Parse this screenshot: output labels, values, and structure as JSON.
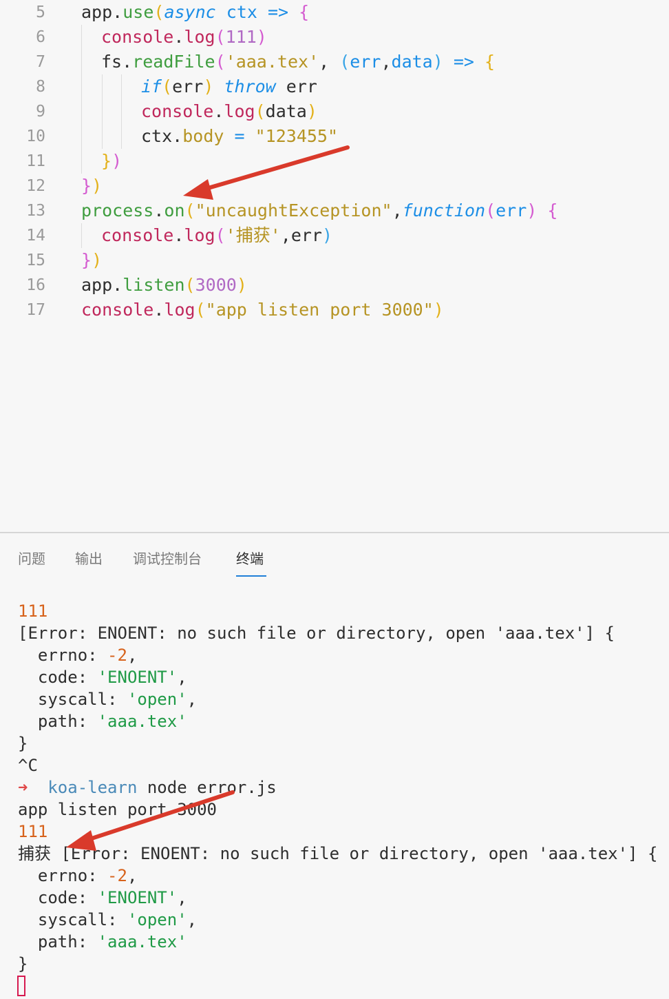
{
  "editor": {
    "lines": [
      {
        "n": "5",
        "segs": [
          [
            "app",
            "id"
          ],
          [
            ".",
            "punc"
          ],
          [
            "use",
            "fn"
          ],
          [
            "(",
            "br1"
          ],
          [
            "async",
            "kw"
          ],
          [
            " ",
            ""
          ],
          [
            "ctx",
            "param"
          ],
          [
            " ",
            ""
          ],
          [
            "=>",
            "arrow"
          ],
          [
            " ",
            ""
          ],
          [
            "{",
            "br2"
          ]
        ]
      },
      {
        "n": "6",
        "segs": [
          [
            "console",
            "log"
          ],
          [
            ".",
            "punc"
          ],
          [
            "log",
            "log"
          ],
          [
            "(",
            "br2"
          ],
          [
            "111",
            "num"
          ],
          [
            ")",
            "br2"
          ]
        ]
      },
      {
        "n": "7",
        "segs": [
          [
            "fs",
            "id"
          ],
          [
            ".",
            "punc"
          ],
          [
            "readFile",
            "fn"
          ],
          [
            "(",
            "br2"
          ],
          [
            "'aaa.tex'",
            "str"
          ],
          [
            ", ",
            ""
          ],
          [
            "(",
            "br3"
          ],
          [
            "err",
            "param"
          ],
          [
            ",",
            "punc"
          ],
          [
            "data",
            "param"
          ],
          [
            ")",
            "br3"
          ],
          [
            " ",
            ""
          ],
          [
            "=>",
            "arrow"
          ],
          [
            " ",
            ""
          ],
          [
            "{",
            "br1"
          ]
        ]
      },
      {
        "n": "8",
        "segs": [
          [
            "if",
            "kw"
          ],
          [
            "(",
            "br1"
          ],
          [
            "err",
            "id"
          ],
          [
            ")",
            "br1"
          ],
          [
            " ",
            ""
          ],
          [
            "throw",
            "kw"
          ],
          [
            " ",
            ""
          ],
          [
            "err",
            "id"
          ]
        ]
      },
      {
        "n": "9",
        "segs": [
          [
            "console",
            "log"
          ],
          [
            ".",
            "punc"
          ],
          [
            "log",
            "log"
          ],
          [
            "(",
            "br1"
          ],
          [
            "data",
            "id"
          ],
          [
            ")",
            "br1"
          ]
        ]
      },
      {
        "n": "10",
        "segs": [
          [
            "ctx",
            "id"
          ],
          [
            ".",
            "punc"
          ],
          [
            "body",
            "str"
          ],
          [
            " ",
            ""
          ],
          [
            "=",
            "arrow"
          ],
          [
            " ",
            ""
          ],
          [
            "\"123455\"",
            "str"
          ]
        ]
      },
      {
        "n": "11",
        "segs": [
          [
            "}",
            "br1"
          ],
          [
            ")",
            "br2"
          ]
        ]
      },
      {
        "n": "12",
        "segs": [
          [
            "}",
            "br2"
          ],
          [
            ")",
            "br1"
          ]
        ]
      },
      {
        "n": "13",
        "segs": [
          [
            "process",
            "fn"
          ],
          [
            ".",
            "punc"
          ],
          [
            "on",
            "fn"
          ],
          [
            "(",
            "br1"
          ],
          [
            "\"uncaughtException\"",
            "str"
          ],
          [
            ",",
            "punc"
          ],
          [
            "function",
            "fnkw"
          ],
          [
            "(",
            "br2"
          ],
          [
            "err",
            "param"
          ],
          [
            ")",
            "br2"
          ],
          [
            " ",
            ""
          ],
          [
            "{",
            "br2"
          ]
        ]
      },
      {
        "n": "14",
        "segs": [
          [
            "console",
            "log"
          ],
          [
            ".",
            "punc"
          ],
          [
            "log",
            "log"
          ],
          [
            "(",
            "br2"
          ],
          [
            "'捕获'",
            "str"
          ],
          [
            ",",
            "punc"
          ],
          [
            "err",
            "id"
          ],
          [
            ")",
            "br3"
          ]
        ]
      },
      {
        "n": "15",
        "segs": [
          [
            "}",
            "br2"
          ],
          [
            ")",
            "br1"
          ]
        ]
      },
      {
        "n": "16",
        "segs": [
          [
            "app",
            "id"
          ],
          [
            ".",
            "punc"
          ],
          [
            "listen",
            "fn"
          ],
          [
            "(",
            "br1"
          ],
          [
            "3000",
            "num"
          ],
          [
            ")",
            "br1"
          ]
        ]
      },
      {
        "n": "17",
        "segs": [
          [
            "console",
            "log"
          ],
          [
            ".",
            "punc"
          ],
          [
            "log",
            "log"
          ],
          [
            "(",
            "br1"
          ],
          [
            "\"app listen port 3000\"",
            "str"
          ],
          [
            ")",
            "br1"
          ]
        ]
      }
    ]
  },
  "panel": {
    "tabs": [
      "问题",
      "输出",
      "调试控制台",
      "终端"
    ],
    "active_tab": "终端"
  },
  "terminal": {
    "lines": [
      [
        [
          "111",
          "orange"
        ]
      ],
      [
        [
          "[Error: ENOENT: no such file or directory, open 'aaa.tex'] {",
          ""
        ]
      ],
      [
        [
          "  errno: ",
          ""
        ],
        [
          "-2",
          "orange"
        ],
        [
          ",",
          ""
        ]
      ],
      [
        [
          "  code: ",
          ""
        ],
        [
          "'ENOENT'",
          "green"
        ],
        [
          ",",
          ""
        ]
      ],
      [
        [
          "  syscall: ",
          ""
        ],
        [
          "'open'",
          "green"
        ],
        [
          ",",
          ""
        ]
      ],
      [
        [
          "  path: ",
          ""
        ],
        [
          "'aaa.tex'",
          "green"
        ]
      ],
      [
        [
          "}",
          ""
        ]
      ],
      [
        [
          "^C",
          ""
        ]
      ],
      [
        [
          "➜",
          "red"
        ],
        [
          "  ",
          ""
        ],
        [
          "koa-learn",
          "blue"
        ],
        [
          " node error.js",
          ""
        ]
      ],
      [
        [
          "app listen port 3000",
          ""
        ]
      ],
      [
        [
          "111",
          "orange"
        ]
      ],
      [
        [
          "捕获 [Error: ENOENT: no such file or directory, open 'aaa.tex'] {",
          ""
        ]
      ],
      [
        [
          "  errno: ",
          ""
        ],
        [
          "-2",
          "orange"
        ],
        [
          ",",
          ""
        ]
      ],
      [
        [
          "  code: ",
          ""
        ],
        [
          "'ENOENT'",
          "green"
        ],
        [
          ",",
          ""
        ]
      ],
      [
        [
          "  syscall: ",
          ""
        ],
        [
          "'open'",
          "green"
        ],
        [
          ",",
          ""
        ]
      ],
      [
        [
          "  path: ",
          ""
        ],
        [
          "'aaa.tex'",
          "green"
        ]
      ],
      [
        [
          "}",
          ""
        ]
      ]
    ]
  },
  "colors": {
    "arrow_annotation": "#d93a2b",
    "cursor": "#d6194f",
    "tab_underline": "#1f7fd8"
  }
}
